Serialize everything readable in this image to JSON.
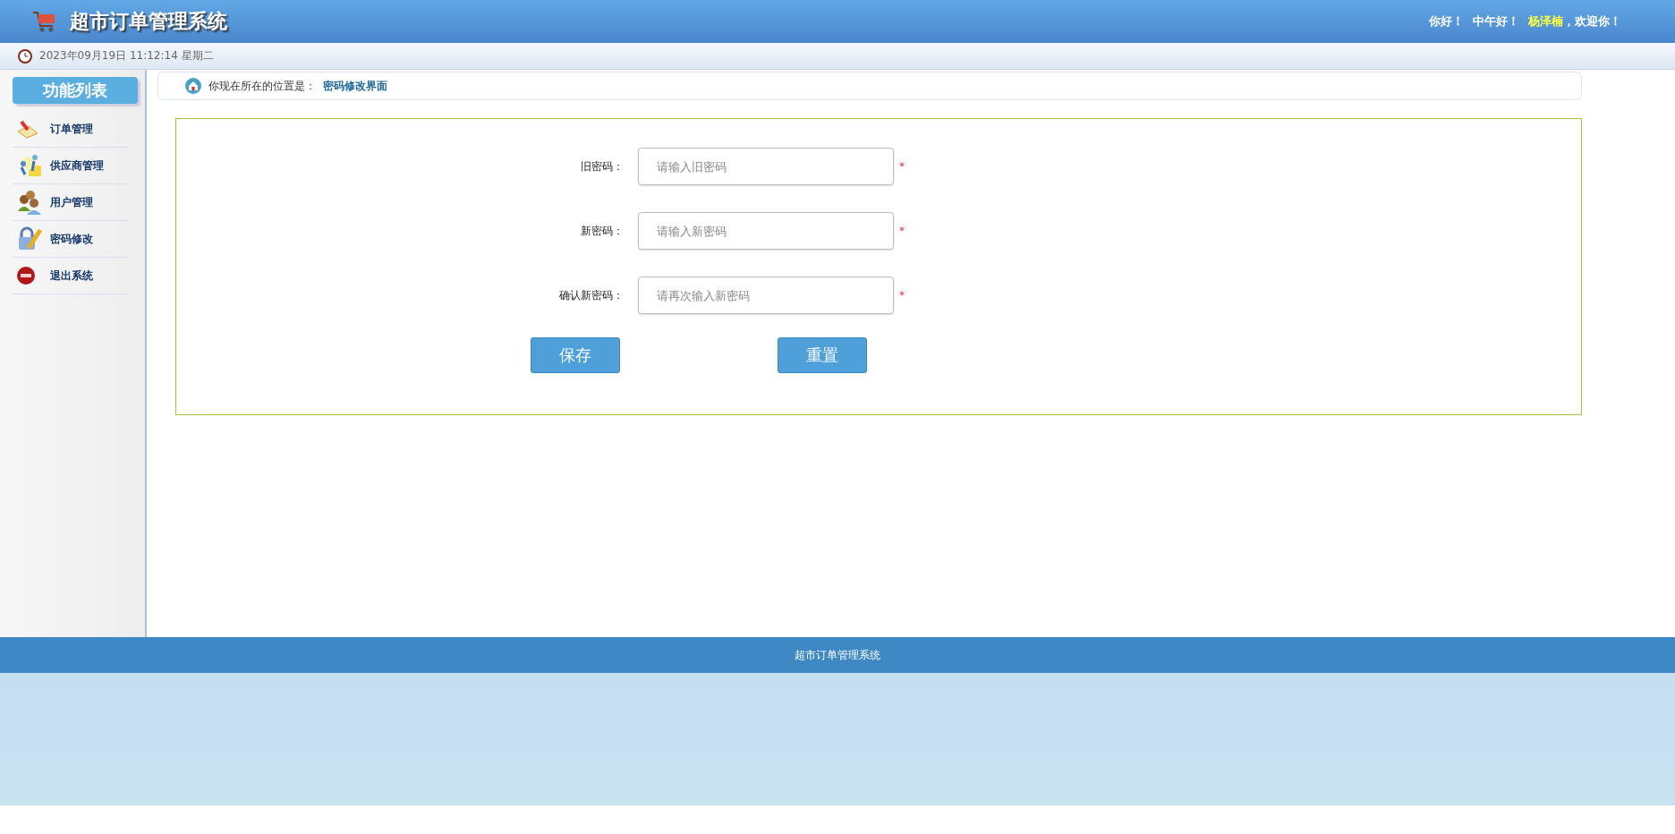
{
  "header": {
    "title": "超市订单管理系统",
    "greeting": "你好！",
    "time_greeting": "中午好！",
    "user": "杨泽楠",
    "welcome": "，欢迎你！"
  },
  "date_bar": {
    "datetime": "2023年09月19日 11:12:14 星期二"
  },
  "sidebar": {
    "heading": "功能列表",
    "items": [
      {
        "label": "订单管理",
        "kind": "order"
      },
      {
        "label": "供应商管理",
        "kind": "supplier"
      },
      {
        "label": "用户管理",
        "kind": "user"
      },
      {
        "label": "密码修改",
        "kind": "password"
      },
      {
        "label": "退出系统",
        "kind": "exit"
      }
    ]
  },
  "breadcrumb": {
    "prefix": "你现在所在的位置是：",
    "location": "密码修改界面"
  },
  "form": {
    "fields": [
      {
        "label": "旧密码：",
        "placeholder": "请输入旧密码",
        "required_mark": "*"
      },
      {
        "label": "新密码：",
        "placeholder": "请输入新密码",
        "required_mark": "*"
      },
      {
        "label": "确认新密码：",
        "placeholder": "请再次输入新密码",
        "required_mark": "*"
      }
    ],
    "buttons": [
      "保存",
      "重置"
    ]
  },
  "footer": {
    "text": "超市订单管理系统"
  }
}
